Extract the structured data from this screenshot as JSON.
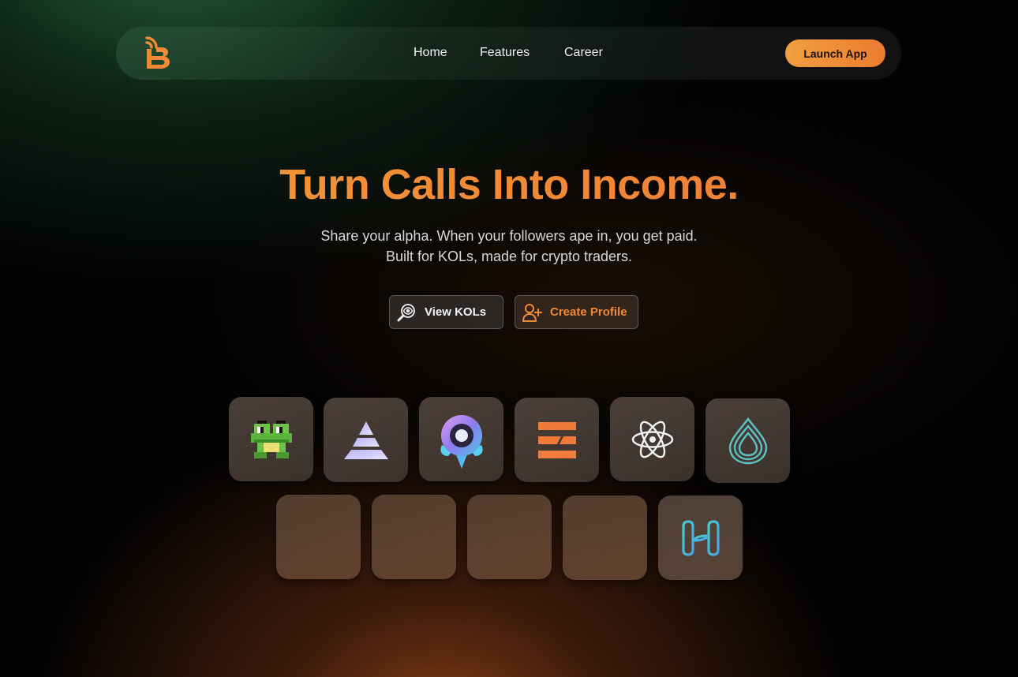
{
  "nav": {
    "logo_icon": "brand-b-logo-icon",
    "links": [
      "Home",
      "Features",
      "Career"
    ],
    "launch_label": "Launch App"
  },
  "hero": {
    "title": "Turn Calls Into Income.",
    "subtitle_line1": "Share your alpha. When your followers ape in, you get paid.",
    "subtitle_line2": "Built for KOLs, made for crypto traders."
  },
  "cta": {
    "view_label": "View KOLs",
    "view_icon": "magnifier-eye-icon",
    "create_label": "Create Profile",
    "create_icon": "add-user-icon"
  },
  "tiles": {
    "row1": [
      "pixel-frog-icon",
      "pyramid-icon",
      "rocket-ring-icon",
      "stacked-bars-icon",
      "atom-icon",
      "water-drop-icon"
    ],
    "row2": [
      "empty-tile",
      "empty-tile",
      "empty-tile",
      "empty-tile",
      "harmony-icon"
    ]
  },
  "colors": {
    "accent": "#ef8a36",
    "teal": "#5cc2c4"
  }
}
